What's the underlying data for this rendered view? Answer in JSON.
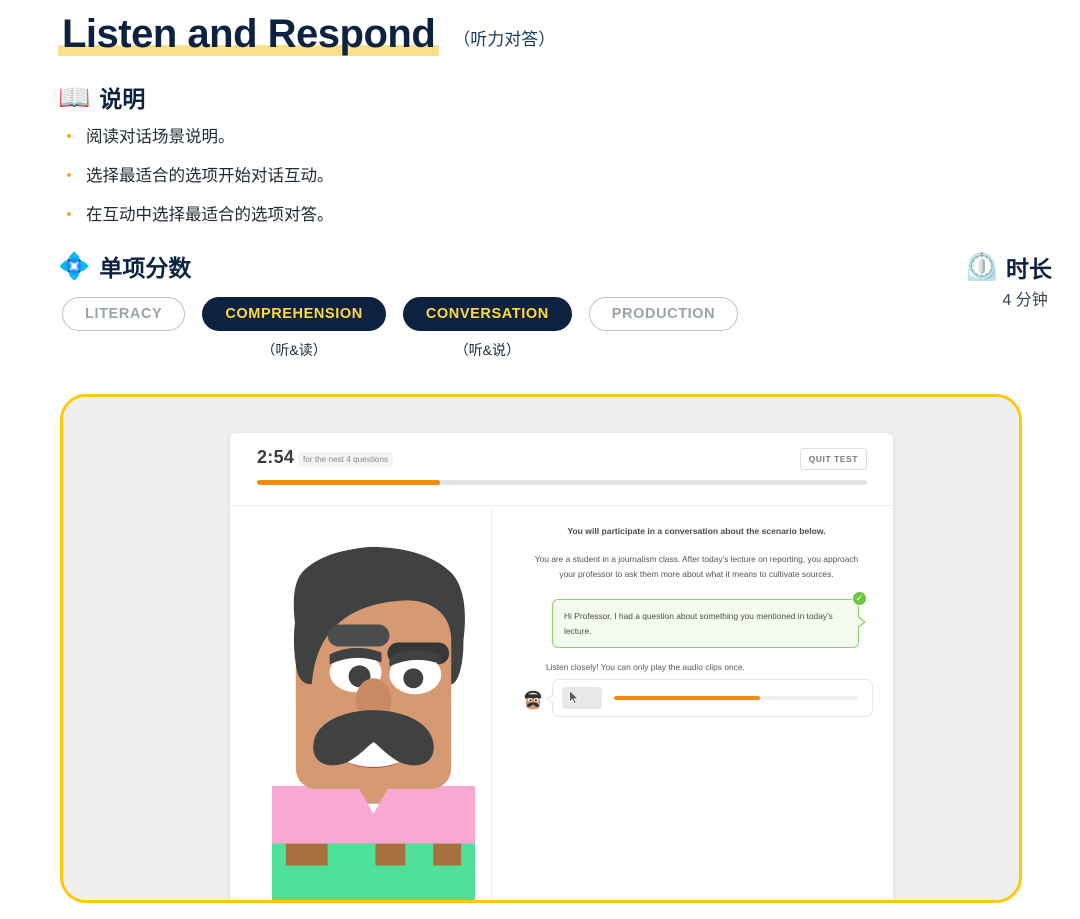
{
  "header": {
    "title_en": "Listen and Respond",
    "title_cn": "（听力对答）"
  },
  "instructions": {
    "icon": "open-book-icon",
    "heading": "说明",
    "items": [
      "阅读对话场景说明。",
      "选择最适合的选项开始对话互动。",
      "在互动中选择最适合的选项对答。"
    ],
    "bullet_glyph": "•"
  },
  "subscores": {
    "icon": "diamond-cluster-icon",
    "heading": "单项分数",
    "pills": [
      {
        "label": "LITERACY",
        "sub": "",
        "active": false
      },
      {
        "label": "COMPREHENSION",
        "sub": "（听&读）",
        "active": true
      },
      {
        "label": "CONVERSATION",
        "sub": "（听&说）",
        "active": true
      },
      {
        "label": "PRODUCTION",
        "sub": "",
        "active": false
      }
    ]
  },
  "duration": {
    "icon": "timer-clock-icon",
    "label": "时长",
    "value": "4 分钟"
  },
  "screenshot": {
    "timer": "2:54",
    "timer_note": "for the nest 4 questions",
    "quit_label": "QUIT TEST",
    "progress_percent": 30,
    "conversation_lead": "You will participate in a conversation about the scenario below.",
    "conversation_body": "You are a student in a journalism class. After today's lecture on reporting, you approach your professor to ask them more about what it means to cultivate sources.",
    "bubble_text": "Hi Professor, I had a question about something you mentioned in today's lecture.",
    "bubble_check": "✓",
    "listen_note": "Listen closely! You can only play the audio clips once.",
    "audio_progress_percent": 60
  },
  "colors": {
    "navy": "#0d2240",
    "highlight_yellow": "#FBE08A",
    "pill_yellow": "#FFD93D",
    "card_border": "#FFC80A",
    "card_fill": "#efefef",
    "bullet_orange": "#F3A922",
    "progress_orange": "#F28C0F",
    "bubble_green": "#8ED16A",
    "check_green": "#6FC63F",
    "shirt_pink": "#F9A8D4",
    "pants_green": "#4FE09A",
    "belt_brown": "#A9703F",
    "hair_dark": "#3F4241",
    "skin": "#D69A72"
  }
}
